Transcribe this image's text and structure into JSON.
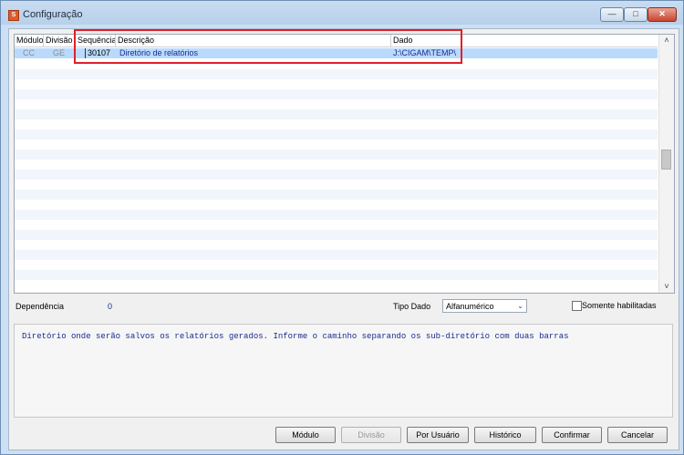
{
  "window": {
    "title": "Configuração",
    "app_icon": "S"
  },
  "window_buttons": {
    "minimize": "—",
    "maximize": "□",
    "close": "✕"
  },
  "grid": {
    "columns": [
      "Módulo",
      "Divisão",
      "Sequência",
      "Descrição",
      "Dado"
    ],
    "rows": [
      {
        "modulo": "CC",
        "divisao": "GE",
        "sequencia": "30107",
        "descricao": "Diretório de relatórios",
        "dado": "J:\\CIGAM\\TEMP\\"
      }
    ],
    "scroll_up": "˄",
    "scroll_down": "˅"
  },
  "fields": {
    "dependencia_label": "Dependência",
    "dependencia_value": "0",
    "tipo_dado_label": "Tipo Dado",
    "tipo_dado_value": "Alfanumérico",
    "tipo_dado_arrow": "⌄",
    "somente_habilitadas_label": "Somente habilitadas"
  },
  "memo": {
    "text": "Diretório onde serão salvos os relatórios gerados. Informe o caminho separando os sub-diretório com duas barras"
  },
  "buttons": {
    "modulo": "Módulo",
    "divisao": "Divisão",
    "por_usuario": "Por Usuário",
    "historico": "Histórico",
    "confirmar": "Confirmar",
    "cancelar": "Cancelar"
  },
  "colors": {
    "selection": "#b9dafd",
    "value_text": "#1a2b8f",
    "highlight_box": "#e0202a"
  }
}
